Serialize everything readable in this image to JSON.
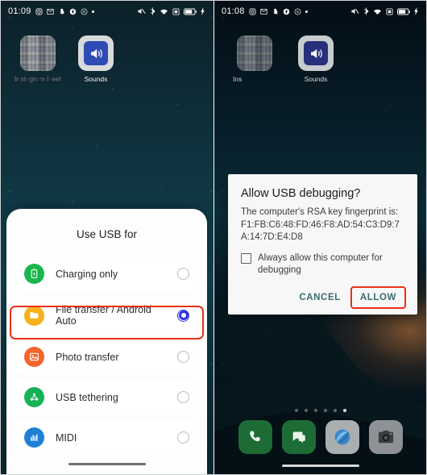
{
  "left_phone": {
    "status_bar": {
      "clock": "01:09",
      "left_icons": [
        "instagram-icon",
        "messenger-icon",
        "snapchat-icon",
        "facebook-icon",
        "circle-b-icon",
        "dot-icon"
      ],
      "right_icons": [
        "volume-mute-icon",
        "bluetooth-icon",
        "wifi-icon",
        "sim-icon",
        "battery-icon",
        "charging-bolt-icon"
      ]
    },
    "apps": [
      {
        "label": "Instagram Reels",
        "icon": "blurred-app-icon",
        "blurred": true
      },
      {
        "label": "Sounds",
        "icon": "speaker-icon",
        "blurred": false
      }
    ],
    "usb_sheet": {
      "title": "Use USB for",
      "options": [
        {
          "label": "Charging only",
          "icon": "battery-charge-icon",
          "icon_color": "#19b74b",
          "selected": false,
          "highlighted": false
        },
        {
          "label": "File transfer / Android Auto",
          "icon": "folder-icon",
          "icon_color": "#f5b21b",
          "selected": true,
          "highlighted": true
        },
        {
          "label": "Photo transfer",
          "icon": "photo-icon",
          "icon_color": "#f4652a",
          "selected": false,
          "highlighted": false
        },
        {
          "label": "USB tethering",
          "icon": "share-nodes-icon",
          "icon_color": "#16b356",
          "selected": false,
          "highlighted": false
        },
        {
          "label": "MIDI",
          "icon": "equalizer-icon",
          "icon_color": "#1f7fd4",
          "selected": false,
          "highlighted": false
        }
      ]
    }
  },
  "right_phone": {
    "status_bar": {
      "clock": "01:08",
      "left_icons": [
        "instagram-icon",
        "messenger-icon",
        "snapchat-icon",
        "facebook-icon",
        "circle-b-icon",
        "dot-icon"
      ],
      "right_icons": [
        "volume-mute-icon",
        "bluetooth-icon",
        "wifi-icon",
        "sim-icon",
        "battery-icon",
        "charging-bolt-icon"
      ]
    },
    "apps": [
      {
        "label": "Ins",
        "icon": "blurred-app-icon",
        "blurred": true
      },
      {
        "label": "Sounds",
        "icon": "speaker-icon",
        "blurred": false
      }
    ],
    "debug_dialog": {
      "title": "Allow USB debugging?",
      "message": "The computer's RSA key fingerprint is:",
      "fingerprint": "F1:FB:C6:48:FD:46:F8:AD:54:C3:D9:7A:14:7D:E4:D8",
      "checkbox_label": "Always allow this computer for debugging",
      "checkbox_checked": false,
      "cancel_label": "CANCEL",
      "allow_label": "ALLOW",
      "allow_highlighted": true,
      "button_color": "#3a6b75"
    },
    "page_dots": {
      "count": 6,
      "active_index": 5
    },
    "dock": [
      {
        "label": "Phone",
        "icon": "phone-icon"
      },
      {
        "label": "Messages",
        "icon": "message-icon"
      },
      {
        "label": "Browser",
        "icon": "browser-icon"
      },
      {
        "label": "Camera",
        "icon": "camera-icon"
      }
    ]
  },
  "annotations": {
    "highlight_color": "#e8301b",
    "boxes": [
      "file-transfer-option",
      "allow-button"
    ]
  }
}
